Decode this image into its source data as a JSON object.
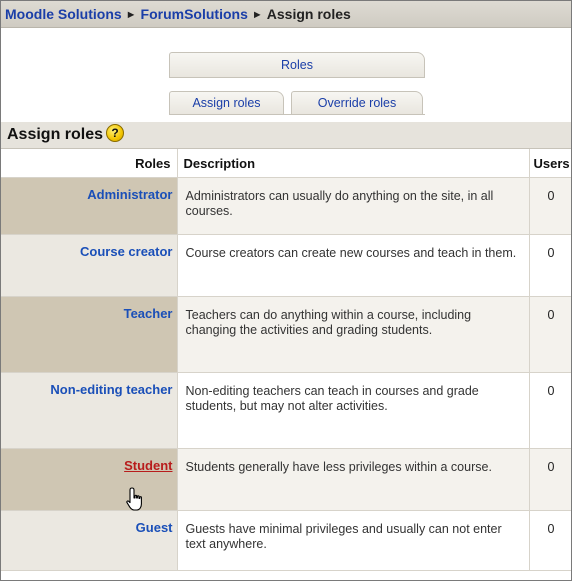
{
  "breadcrumb": {
    "items": [
      "Moodle Solutions",
      "ForumSolutions"
    ],
    "current": "Assign roles",
    "separator": "►"
  },
  "tabs": {
    "top": "Roles",
    "assign": "Assign roles",
    "override": "Override roles"
  },
  "heading": {
    "title": "Assign roles",
    "help_icon": "?"
  },
  "table": {
    "columns": [
      "Roles",
      "Description",
      "Users"
    ],
    "rows": [
      {
        "role": "Administrator",
        "description": "Administrators can usually do anything on the site, in all courses.",
        "users": "0"
      },
      {
        "role": "Course creator",
        "description": "Course creators can create new courses and teach in them.",
        "users": "0"
      },
      {
        "role": "Teacher",
        "description": "Teachers can do anything within a course, including changing the activities and grading students.",
        "users": "0"
      },
      {
        "role": "Non-editing teacher",
        "description": "Non-editing teachers can teach in courses and grade students, but may not alter activities.",
        "users": "0"
      },
      {
        "role": "Student",
        "description": "Students generally have less privileges within a course.",
        "users": "0"
      },
      {
        "role": "Guest",
        "description": "Guests have minimal privileges and usually can not enter text anywhere.",
        "users": "0"
      }
    ]
  },
  "colors": {
    "link": "#1a4fb8",
    "link_hover": "#b81c1c",
    "role_cell_dark": "#cfc6b3",
    "role_cell_light": "#ebe8e1"
  },
  "cursor": {
    "icon": "hand-pointer-icon"
  }
}
